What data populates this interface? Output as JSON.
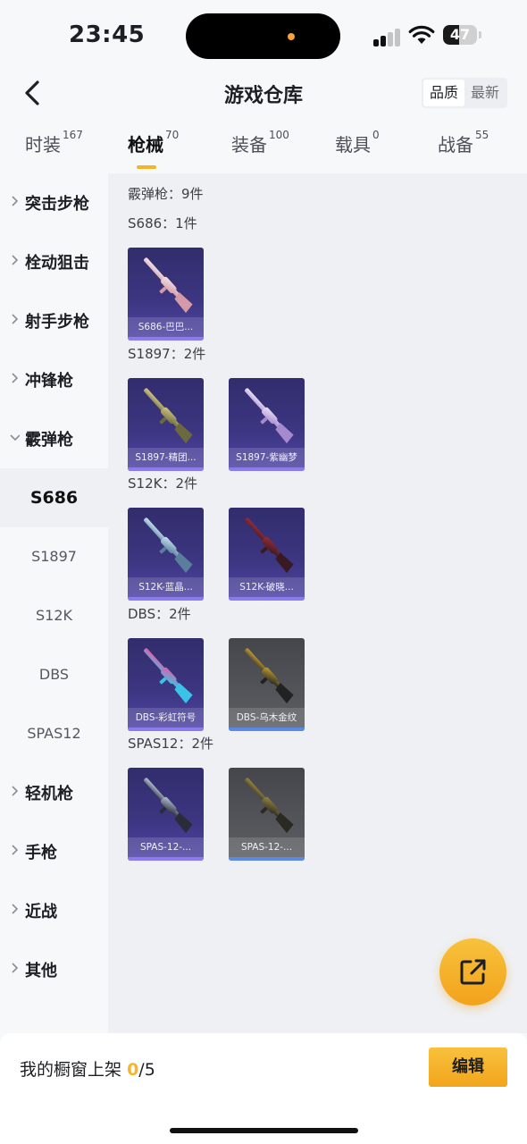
{
  "status_bar": {
    "time": "23:45",
    "battery": "47",
    "battery_level": 0.47
  },
  "header": {
    "title": "游戏仓库",
    "sort_options": [
      "品质",
      "最新"
    ],
    "sort_active": "品质"
  },
  "tabs": [
    {
      "label": "时装",
      "count": "167"
    },
    {
      "label": "枪械",
      "count": "70"
    },
    {
      "label": "装备",
      "count": "100"
    },
    {
      "label": "载具",
      "count": "0"
    },
    {
      "label": "战备",
      "count": "55"
    }
  ],
  "active_tab": "枪械",
  "sidebar": {
    "categories": [
      "突击步枪",
      "栓动狙击",
      "射手步枪",
      "冲锋枪",
      "霰弹枪"
    ],
    "subcategories": [
      "S686",
      "S1897",
      "S12K",
      "DBS",
      "SPAS12"
    ],
    "categories_after": [
      "轻机枪",
      "手枪",
      "近战",
      "其他"
    ]
  },
  "content": {
    "summary": "霰弹枪：9件",
    "groups": [
      {
        "title": "S686：1件",
        "items": [
          {
            "name": "S686-巴巴...",
            "rarity": "purple",
            "icon": "shotgun-s686"
          }
        ]
      },
      {
        "title": "S1897：2件",
        "items": [
          {
            "name": "S1897-精团...",
            "rarity": "purple",
            "icon": "shotgun-s1897-gold"
          },
          {
            "name": "S1897-紫幽梦",
            "rarity": "purple",
            "icon": "shotgun-s1897-lilac"
          }
        ]
      },
      {
        "title": "S12K：2件",
        "items": [
          {
            "name": "S12K-蓝晶...",
            "rarity": "purple",
            "icon": "shotgun-s12k-blue"
          },
          {
            "name": "S12K-破晓...",
            "rarity": "purple",
            "icon": "shotgun-s12k-red"
          }
        ]
      },
      {
        "title": "DBS：2件",
        "items": [
          {
            "name": "DBS-彩虹符号",
            "rarity": "purple",
            "icon": "shotgun-dbs-rainbow"
          },
          {
            "name": "DBS-乌木金纹",
            "rarity": "gray",
            "icon": "shotgun-dbs-gold"
          }
        ]
      },
      {
        "title": "SPAS12：2件",
        "items": [
          {
            "name": "SPAS-12-...",
            "rarity": "purple",
            "icon": "shotgun-spas12"
          },
          {
            "name": "SPAS-12-...",
            "rarity": "gray",
            "icon": "shotgun-spas12-olive"
          }
        ]
      }
    ]
  },
  "bottom_bar": {
    "label": "我的橱窗上架",
    "count": "0",
    "total": "/5",
    "edit_label": "编辑"
  },
  "colors": {
    "accent": "#f5b52c",
    "purple_card": "#3c3580",
    "gray_card": "#54555a"
  }
}
